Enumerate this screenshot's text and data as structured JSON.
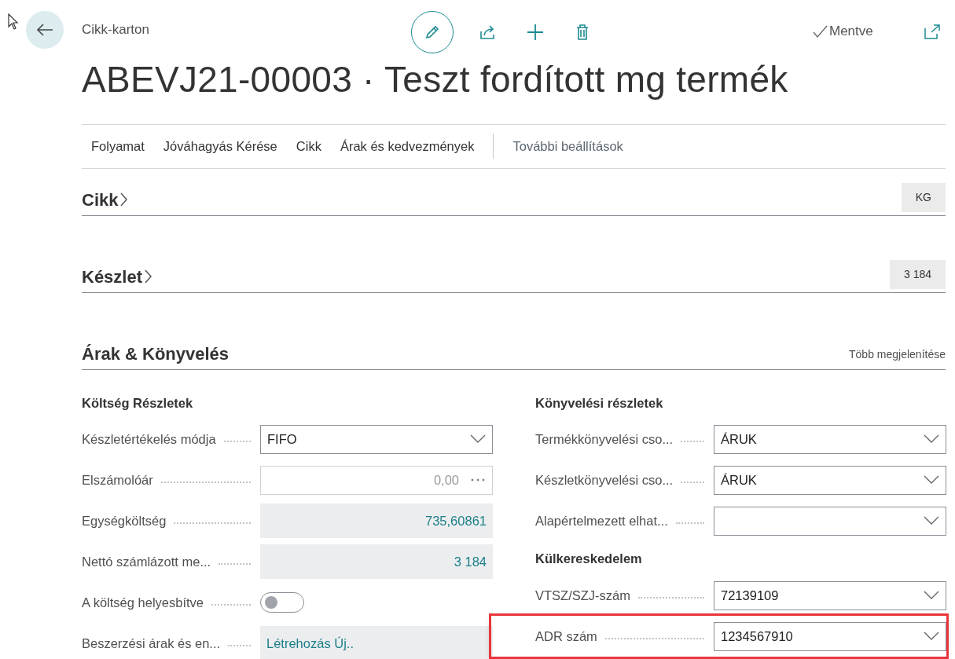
{
  "header": {
    "caption": "Cikk-karton",
    "title": "ABEVJ21-00003 · Teszt fordított mg termék",
    "status": "Mentve"
  },
  "actions": [
    {
      "label": "Folyamat",
      "kind": "main"
    },
    {
      "label": "Jóváhagyás Kérése",
      "kind": "main"
    },
    {
      "label": "Cikk",
      "kind": "main"
    },
    {
      "label": "Árak és kedvezmények",
      "kind": "main"
    },
    {
      "label": "További beállítások",
      "kind": "more"
    }
  ],
  "sections": [
    {
      "title": "Cikk",
      "expanded": false,
      "summary": "KG"
    },
    {
      "title": "Készlet",
      "expanded": false,
      "summary": "3 184"
    },
    {
      "title": "Árak & Könyvelés",
      "expanded": true,
      "link": "Több megjelenítése",
      "columns": [
        {
          "groups": [
            {
              "heading": "Költség Részletek",
              "fields": [
                {
                  "label": "Készletértékelés módja",
                  "kind": "dropdown",
                  "value": "FIFO",
                  "highlighted": false
                },
                {
                  "label": "Elszámolóár",
                  "kind": "lookup",
                  "value": "0,00",
                  "highlighted": false
                },
                {
                  "label": "Egységköltség",
                  "kind": "readonly",
                  "value": "735,60861",
                  "highlighted": false
                },
                {
                  "label": "Nettó számlázott me...",
                  "kind": "readonly",
                  "value": "3 184",
                  "highlighted": false
                },
                {
                  "label": "A költség helyesbítve",
                  "kind": "toggle",
                  "on": false,
                  "highlighted": false
                },
                {
                  "label": "Beszerzési árak és en...",
                  "kind": "link",
                  "value": "Létrehozás Új..",
                  "highlighted": false
                }
              ]
            }
          ]
        },
        {
          "groups": [
            {
              "heading": "Könyvelési részletek",
              "fields": [
                {
                  "label": "Termékkönyvelési cso...",
                  "kind": "dropdown",
                  "value": "ÁRUK",
                  "highlighted": false
                },
                {
                  "label": "Készletkönyvelési cso...",
                  "kind": "dropdown",
                  "value": "ÁRUK",
                  "highlighted": false
                },
                {
                  "label": "Alapértelmezett elhat...",
                  "kind": "dropdown",
                  "highlighted": false
                }
              ]
            },
            {
              "heading": "Külkereskedelem",
              "fields": [
                {
                  "label": "VTSZ/SZJ-szám",
                  "kind": "dropdown",
                  "value": "72139109",
                  "highlighted": false
                },
                {
                  "label": "ADR szám",
                  "kind": "dropdown",
                  "value": "1234567910",
                  "highlighted": true
                }
              ]
            }
          ]
        }
      ]
    }
  ]
}
